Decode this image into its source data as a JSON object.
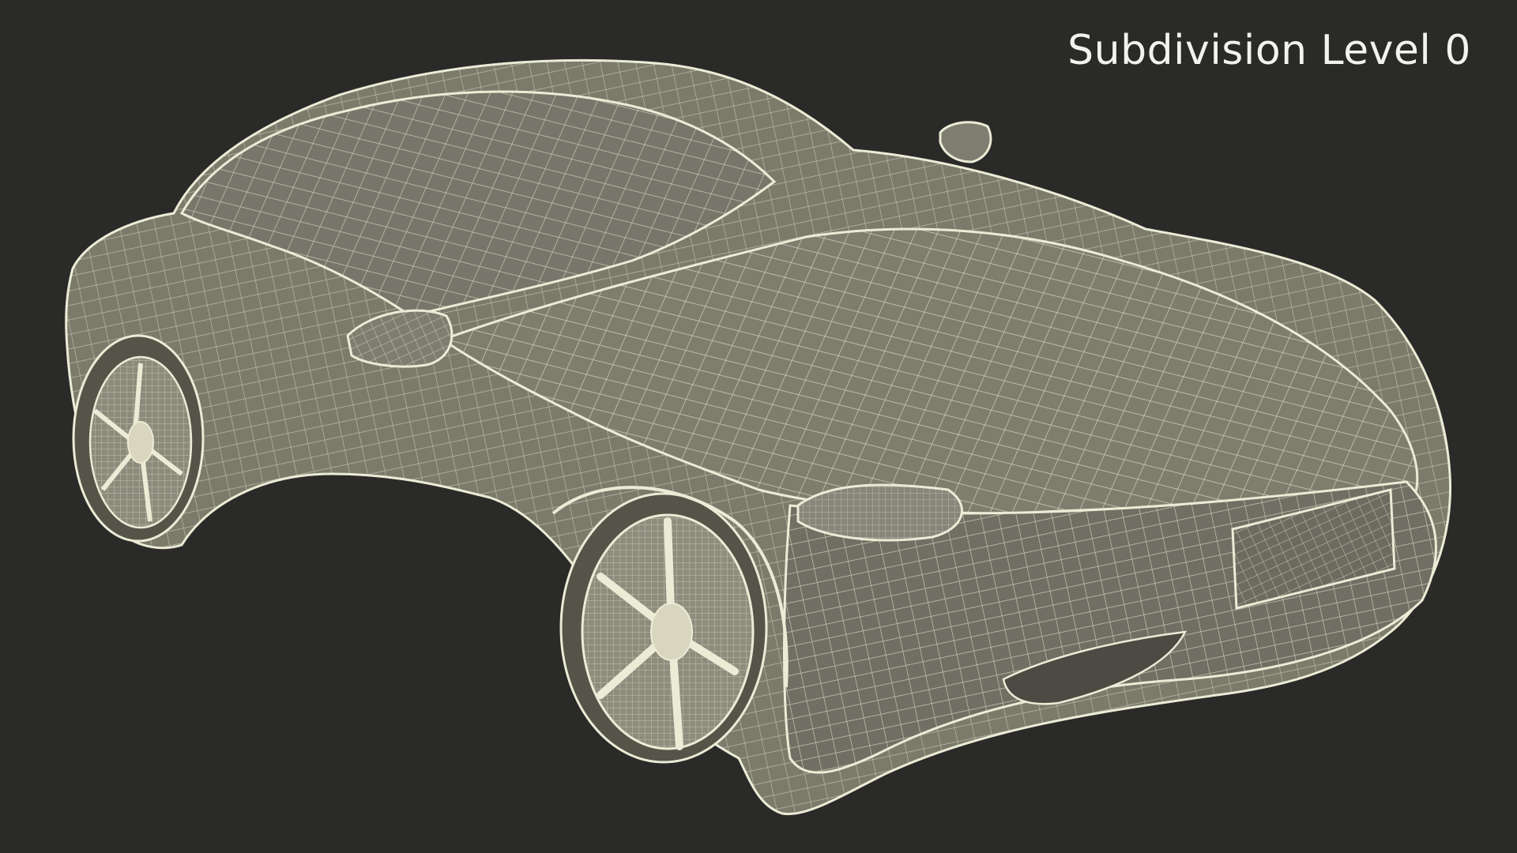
{
  "viewport": {
    "label": "Subdivision Level 0"
  },
  "colors": {
    "background": "#2a2a29",
    "body_fill": "#7b7b6c",
    "wire": "#ecebd6",
    "label_text": "#f2f2f0"
  },
  "model": {
    "subject": "sports-car-wireframe",
    "display_mode": "wireframe-shaded"
  }
}
